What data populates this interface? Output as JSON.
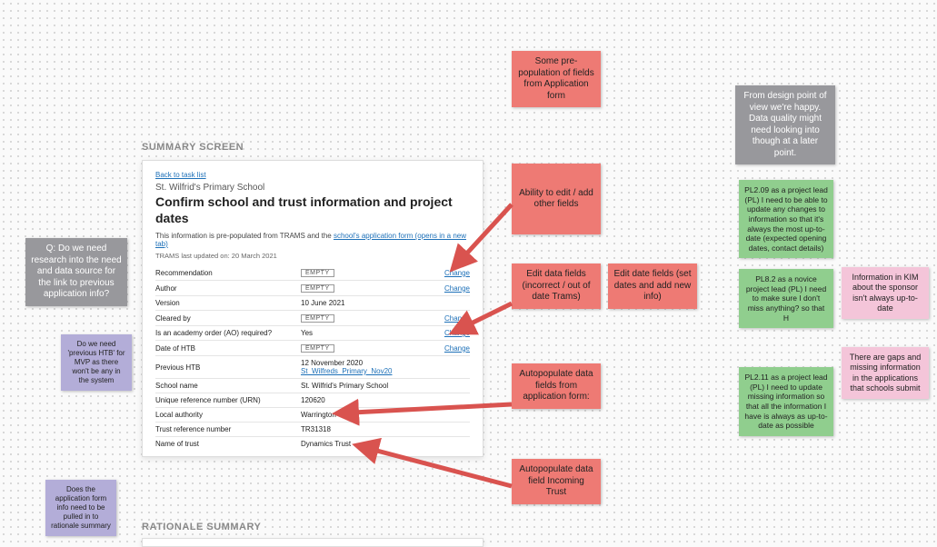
{
  "labels": {
    "summary": "SUMMARY SCREEN",
    "rationale": "RATIONALE SUMMARY"
  },
  "form": {
    "backlink": "Back to task list",
    "caption": "St. Wilfrid's Primary School",
    "heading": "Confirm school and trust information and project dates",
    "intro_prefix": "This information is pre-populated from TRAMS and the ",
    "intro_link": "school's application form (opens in a new tab)",
    "meta": "TRAMS last updated on: 20 March 2021",
    "empty_badge": "EMPTY",
    "rows": {
      "recommendation": {
        "label": "Recommendation",
        "change": "Change"
      },
      "author": {
        "label": "Author",
        "change": "Change"
      },
      "version": {
        "label": "Version",
        "value": "10 June 2021"
      },
      "cleared_by": {
        "label": "Cleared by",
        "change": "Change"
      },
      "ao_required": {
        "label": "Is an academy order (AO) required?",
        "value": "Yes",
        "change": "Change"
      },
      "date_htb": {
        "label": "Date of HTB",
        "change": "Change"
      },
      "previous_htb": {
        "label": "Previous HTB",
        "value_line1": "12 November 2020",
        "value_link": "St_Wilfreds_Primary_Nov20"
      },
      "school_name": {
        "label": "School name",
        "value": "St. Wilfrid's Primary School"
      },
      "urn": {
        "label": "Unique reference number (URN)",
        "value": "120620"
      },
      "la": {
        "label": "Local authority",
        "value": "Warrington"
      },
      "trust_ref": {
        "label": "Trust reference number",
        "value": "TR31318"
      },
      "trust_name": {
        "label": "Name of trust",
        "value": "Dynamics Trust"
      }
    }
  },
  "stickies": {
    "red1": "Some pre-population of fields from Application form",
    "red2": "Ability to edit / add other fields",
    "red3": "Edit data fields (incorrect / out of date Trams)",
    "red4": "Edit date fields (set dates and add new info)",
    "red5": "Autopopulate data fields from application form:",
    "red6": "Autopopulate data field Incoming Trust",
    "grey1": "Q: Do we need research into the need and data source for the link to previous application info?",
    "grey2": "From design point of view we're happy. Data quality might need looking into though at a later point.",
    "green1": "PL2.09 as a project lead (PL) I need to be able to update any changes to information so that it's always the most up-to-date (expected opening dates, contact details)",
    "green2": "PL8.2 as a novice project lead (PL) I need to make sure I don't miss anything? so that H",
    "green3": "PL2.11 as a project lead (PL) I need to update missing information so that all the information I have is always as up-to-date as possible",
    "pink1": "Information in KIM about the sponsor isn't always up-to-date",
    "pink2": "There are gaps and missing information in the applications that schools submit",
    "purple1": "Do we need 'previous HTB' for MVP as there won't be any in the system",
    "purple2": "Does the application form info need to be pulled in to rationale summary"
  }
}
